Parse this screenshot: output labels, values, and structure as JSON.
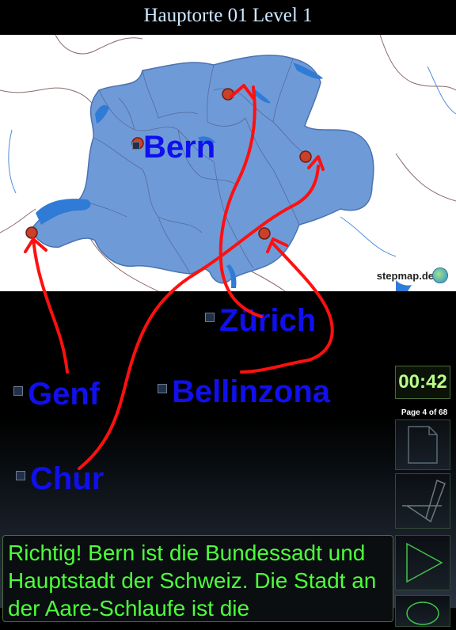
{
  "header": {
    "title": "Hauptorte 01 Level 1"
  },
  "map": {
    "credit": "stepmap.de",
    "target_label": "Bern",
    "colors": {
      "country_fill": "#6e9bd8",
      "lakes": "#2f7bd6",
      "marker": "#c9412a",
      "arrows": "#ff1010"
    }
  },
  "answers": [
    {
      "name": "Zürich"
    },
    {
      "name": "Genf"
    },
    {
      "name": "Bellinzona"
    },
    {
      "name": "Chur"
    }
  ],
  "timer": {
    "value": "00:42"
  },
  "pager": {
    "text": "Page 4 of 68"
  },
  "controls": {
    "icons": [
      "page-icon",
      "pencil-icon",
      "play-icon",
      "circle-icon"
    ]
  },
  "feedback": {
    "text": "Richtig! Bern ist die Bundessadt und Hauptstadt der Schweiz. Die Stadt an der Aare-Schlaufe ist die"
  }
}
